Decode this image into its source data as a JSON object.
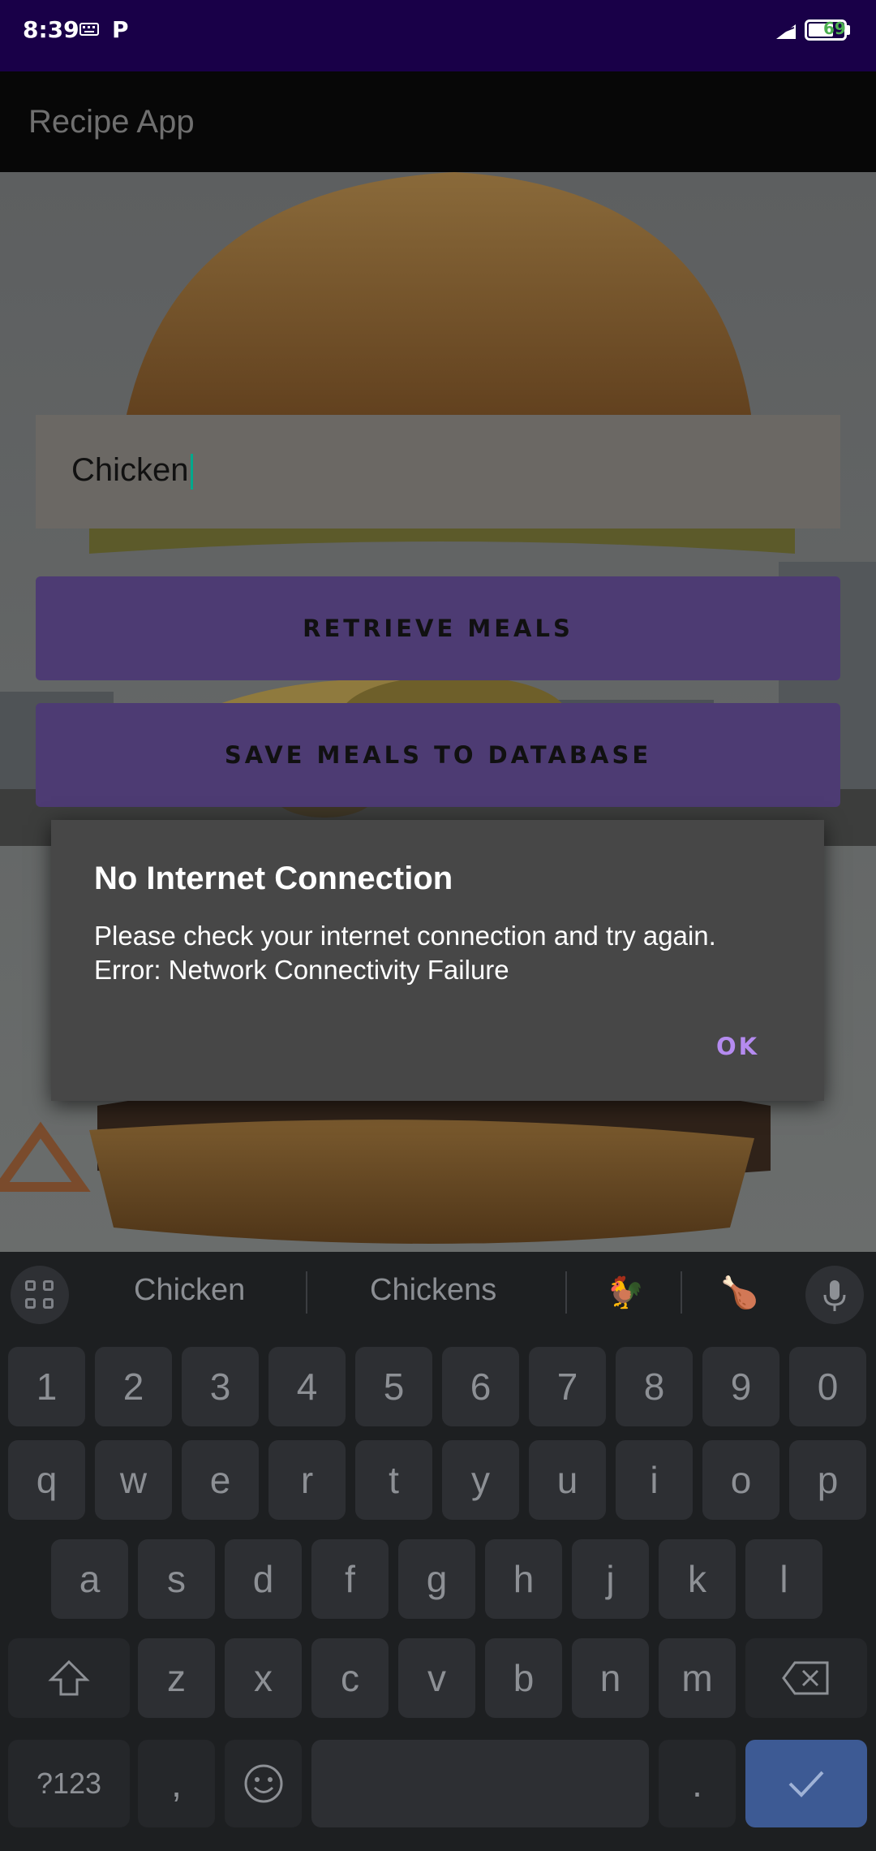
{
  "status_bar": {
    "time": "8:39",
    "battery": "69"
  },
  "app_bar": {
    "title": "Recipe App"
  },
  "search": {
    "value": "Chicken"
  },
  "buttons": {
    "retrieve": "RETRIEVE MEALS",
    "save": "SAVE MEALS TO DATABASE"
  },
  "dialog": {
    "title": "No Internet Connection",
    "message_line1": "Please check your internet connection and try again.",
    "message_line2": "Error: Network Connectivity Failure",
    "ok": "OK"
  },
  "keyboard": {
    "suggestions": [
      "Chicken",
      "Chickens"
    ],
    "emoji_suggestions": [
      "🐓",
      "🍗"
    ],
    "number_row": [
      "1",
      "2",
      "3",
      "4",
      "5",
      "6",
      "7",
      "8",
      "9",
      "0"
    ],
    "row1": [
      "q",
      "w",
      "e",
      "r",
      "t",
      "y",
      "u",
      "i",
      "o",
      "p"
    ],
    "row2": [
      "a",
      "s",
      "d",
      "f",
      "g",
      "h",
      "j",
      "k",
      "l"
    ],
    "row3": [
      "z",
      "x",
      "c",
      "v",
      "b",
      "n",
      "m"
    ],
    "symbols_label": "?123",
    "comma": ",",
    "period": "."
  },
  "colors": {
    "status_bar": "#190048",
    "button_fill": "#4d3b73",
    "dialog_bg": "#474747",
    "dialog_action": "#b58bf0",
    "keyboard_bg": "#1d1f21",
    "enter_key": "#3d5a94"
  }
}
